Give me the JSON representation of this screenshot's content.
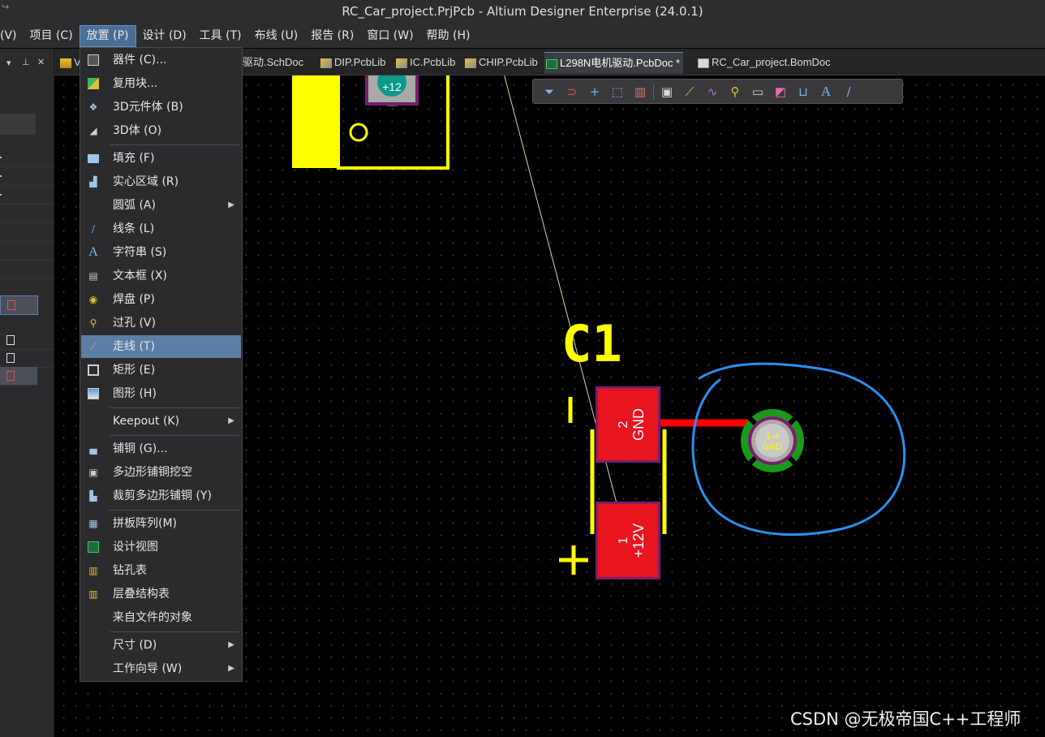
{
  "window": {
    "title": "RC_Car_project.PrjPcb - Altium Designer Enterprise (24.0.1)"
  },
  "menubar": {
    "items": [
      {
        "label": "(V)"
      },
      {
        "label": "项目 (C)"
      },
      {
        "label": "放置 (P)"
      },
      {
        "label": "设计 (D)"
      },
      {
        "label": "工具 (T)"
      },
      {
        "label": "布线 (U)"
      },
      {
        "label": "报告 (R)"
      },
      {
        "label": "窗口 (W)"
      },
      {
        "label": "帮助 (H)"
      }
    ],
    "active_index": 2
  },
  "tabs": [
    {
      "label": "V"
    },
    {
      "label": "机驱动.SchDoc"
    },
    {
      "label": "DIP.PcbLib"
    },
    {
      "label": "IC.PcbLib"
    },
    {
      "label": "CHIP.PcbLib"
    },
    {
      "label": "L298N电机驱动.PcbDoc *"
    },
    {
      "label": "RC_Car_project.BomDoc"
    }
  ],
  "active_tab": "L298N电机驱动.PcbDoc *",
  "place_menu": {
    "items": [
      {
        "icon": "component-icon",
        "label": "器件 (C)..."
      },
      {
        "icon": "reuse-block-icon",
        "label": "复用块..."
      },
      {
        "icon": "3d-component-icon",
        "label": "3D元件体 (B)"
      },
      {
        "icon": "3d-body-icon",
        "label": "3D体 (O)"
      },
      {
        "icon": "fill-icon",
        "label": "填充 (F)"
      },
      {
        "icon": "solid-region-icon",
        "label": "实心区域 (R)"
      },
      {
        "icon": "",
        "label": "圆弧 (A)",
        "submenu": true
      },
      {
        "icon": "line-icon",
        "label": "线条 (L)"
      },
      {
        "icon": "string-icon",
        "label": "字符串 (S)"
      },
      {
        "icon": "text-frame-icon",
        "label": "文本框 (X)"
      },
      {
        "icon": "pad-icon",
        "label": "焊盘 (P)"
      },
      {
        "icon": "via-icon",
        "label": "过孔 (V)"
      },
      {
        "icon": "track-icon",
        "label": "走线 (T)",
        "highlighted": true
      },
      {
        "icon": "rectangle-icon",
        "label": "矩形 (E)"
      },
      {
        "icon": "graphic-icon",
        "label": "图形 (H)"
      },
      {
        "icon": "",
        "label": "Keepout (K)",
        "submenu": true
      },
      {
        "icon": "polygon-pour-icon",
        "label": "铺铜 (G)..."
      },
      {
        "icon": "polygon-cutout-icon",
        "label": "多边形铺铜挖空"
      },
      {
        "icon": "slice-polygon-icon",
        "label": "裁剪多边形铺铜 (Y)"
      },
      {
        "icon": "embedded-board-array-icon",
        "label": "拼板阵列(M)"
      },
      {
        "icon": "design-view-icon",
        "label": "设计视图"
      },
      {
        "icon": "drill-table-icon",
        "label": "钻孔表"
      },
      {
        "icon": "layer-stack-table-icon",
        "label": "层叠结构表"
      },
      {
        "icon": "",
        "label": "来自文件的对象"
      },
      {
        "icon": "",
        "label": "尺寸 (D)",
        "submenu": true
      },
      {
        "icon": "",
        "label": "工作向导 (W)",
        "submenu": true
      }
    ]
  },
  "pcb": {
    "designator": "C1",
    "pad2": {
      "number": "2",
      "net": "GND"
    },
    "pad1": {
      "number": "1",
      "net": "+12V"
    },
    "via": {
      "line1": "1-4",
      "line2": "GND"
    },
    "top_component_pad": "+12",
    "polarity_minus": "-",
    "polarity_plus": "+"
  },
  "colors": {
    "pad": "#e8141e",
    "silkscreen": "#ffff00",
    "track": "#ff0000",
    "annotation": "#2a8ff0",
    "via_ring": "#1a9a1a"
  },
  "watermark": "CSDN @无极帝国C++工程师"
}
